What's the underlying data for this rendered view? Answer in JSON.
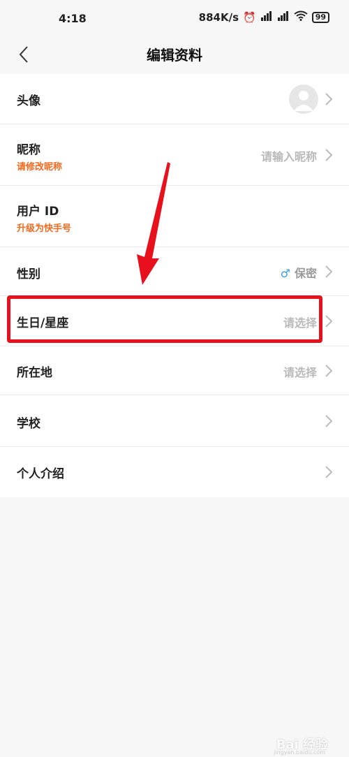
{
  "status_bar": {
    "time": "4:18",
    "network_speed": "884K/s",
    "battery": "99"
  },
  "header": {
    "title": "编辑资料"
  },
  "rows": {
    "avatar": {
      "label": "头像"
    },
    "nickname": {
      "label": "昵称",
      "hint": "请修改昵称",
      "value": "请输入昵称"
    },
    "user_id": {
      "label": "用户 ID",
      "hint": "升级为快手号"
    },
    "gender": {
      "label": "性别",
      "icon": "♂",
      "value": "保密"
    },
    "birthday": {
      "label": "生日/星座",
      "value": "请选择"
    },
    "location": {
      "label": "所在地",
      "value": "请选择"
    },
    "school": {
      "label": "学校"
    },
    "intro": {
      "label": "个人介绍"
    }
  },
  "colors": {
    "accent_orange": "#f06a1f",
    "highlight_red": "#e8101c",
    "gender_blue": "#3b9ce8"
  },
  "watermark": {
    "text": "Bai 经验",
    "sub": "jingyan.baidu.com"
  }
}
